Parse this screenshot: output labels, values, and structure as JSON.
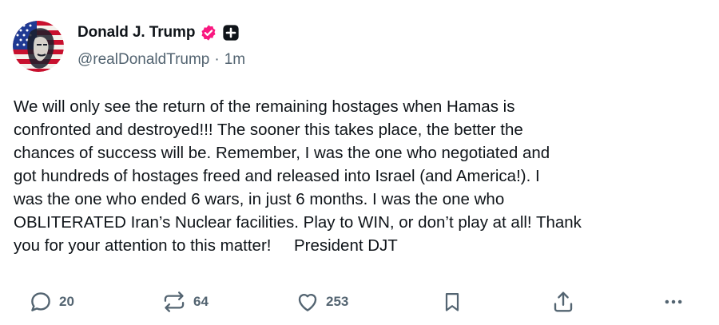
{
  "author": {
    "display_name": "Donald J. Trump",
    "handle": "@realDonaldTrump",
    "separator": "·",
    "time_ago": "1m",
    "verified_badge_color": "#f91880",
    "avatar_icon": "american-flag-portrait",
    "extra_badge_icon": "plus-icon"
  },
  "post": {
    "text": "We will only see the return of the remaining hostages when Hamas is\nconfronted and destroyed!!! The sooner this takes place, the better the\nchances of success will be. Remember, I was the one who negotiated and\ngot hundreds of hostages freed and released into Israel (and America!). I\nwas the one who ended 6 wars, in just 6 months. I was the one who\nOBLITERATED Iran’s Nuclear facilities. Play to WIN, or don’t play at all! Thank\nyou for your attention to this matter!     President DJT"
  },
  "actions": {
    "reply": {
      "icon": "reply-icon",
      "count": "20"
    },
    "retruth": {
      "icon": "retruth-icon",
      "count": "64"
    },
    "like": {
      "icon": "heart-icon",
      "count": "253"
    },
    "bookmark": {
      "icon": "bookmark-icon"
    },
    "share": {
      "icon": "share-icon"
    },
    "more": {
      "icon": "more-icon"
    }
  },
  "colors": {
    "text": "#0f1419",
    "secondary": "#536471",
    "background": "#ffffff"
  }
}
